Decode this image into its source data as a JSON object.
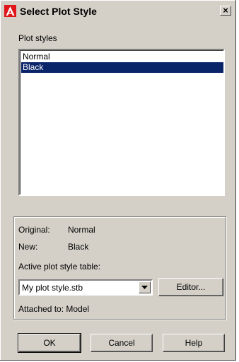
{
  "window": {
    "title": "Select Plot Style",
    "close_label": "×"
  },
  "plot_styles": {
    "label": "Plot styles",
    "items": [
      {
        "label": "Normal",
        "selected": false
      },
      {
        "label": "Black",
        "selected": true
      }
    ]
  },
  "info": {
    "original_label": "Original:",
    "original_value": "Normal",
    "new_label": "New:",
    "new_value": "Black",
    "active_table_label": "Active plot style table:",
    "active_table_value": "My plot style.stb",
    "editor_button": "Editor...",
    "attached_to": "Attached to: Model"
  },
  "buttons": {
    "ok": "OK",
    "cancel": "Cancel",
    "help": "Help"
  },
  "colors": {
    "selection": "#0a246a",
    "dialog_bg": "#d4d0c8",
    "icon_red": "#e0161b"
  },
  "icons": {
    "app": "autocad-logo-icon",
    "close": "close-icon",
    "dropdown": "chevron-down-icon"
  }
}
